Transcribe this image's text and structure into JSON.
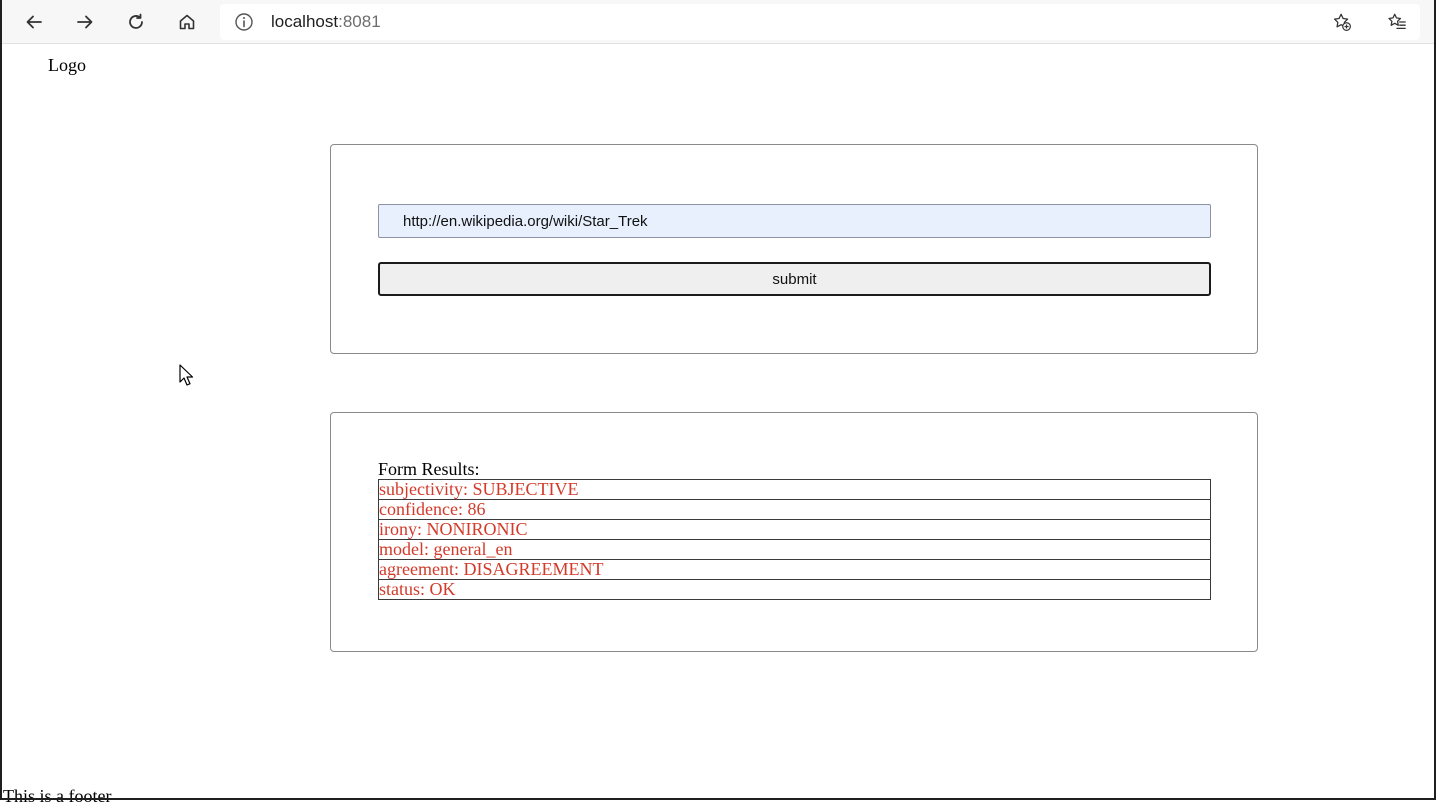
{
  "browser": {
    "url_host": "localhost",
    "url_port": ":8081",
    "icons": {
      "back": "back-arrow-icon",
      "forward": "forward-arrow-icon",
      "reload": "reload-icon",
      "home": "home-icon",
      "info": "info-icon",
      "add_favorite": "star-plus-icon",
      "favorites": "favorites-list-icon"
    }
  },
  "page": {
    "logo": "Logo",
    "form": {
      "url_value": "http://en.wikipedia.org/wiki/Star_Trek",
      "submit_label": "submit"
    },
    "results": {
      "heading": "Form Results:",
      "rows": [
        "subjectivity: SUBJECTIVE",
        "confidence: 86",
        "irony: NONIRONIC",
        "model: general_en",
        "agreement: DISAGREEMENT",
        "status: OK"
      ]
    },
    "footer": "This is a footer"
  },
  "colors": {
    "result_text": "#d23a2a",
    "input_background": "#e8f0fe",
    "toolbar_background": "#f7f7f7"
  }
}
